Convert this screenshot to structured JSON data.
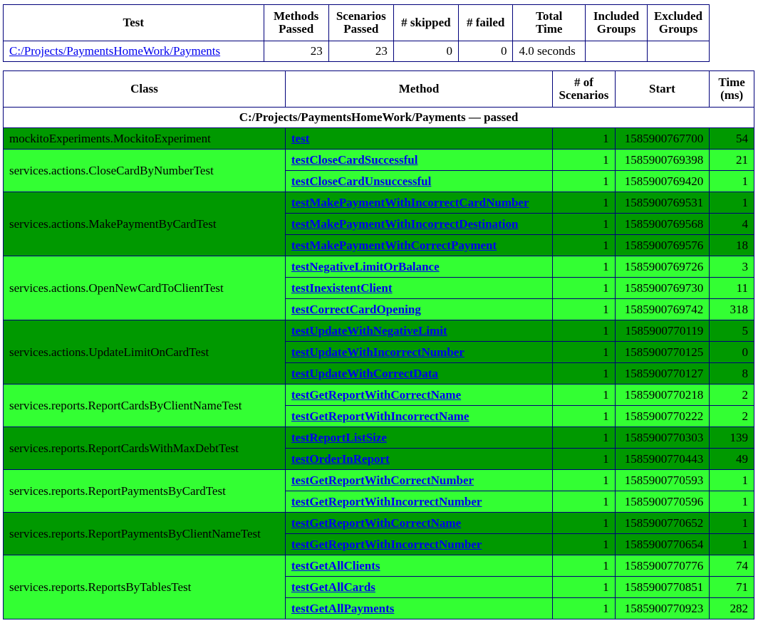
{
  "summary": {
    "headers": [
      "Test",
      "Methods\nPassed",
      "Scenarios\nPassed",
      "# skipped",
      "# failed",
      "Total\nTime",
      "Included\nGroups",
      "Excluded\nGroups"
    ],
    "row": {
      "test": "C:/Projects/PaymentsHomeWork/Payments",
      "methods_passed": "23",
      "scenarios_passed": "23",
      "skipped": "0",
      "failed": "0",
      "total_time": "4.0 seconds",
      "included_groups": "",
      "excluded_groups": ""
    }
  },
  "detail": {
    "headers": [
      "Class",
      "Method",
      "# of\nScenarios",
      "Start",
      "Time\n(ms)"
    ],
    "suite_title": "C:/Projects/PaymentsHomeWork/Payments — passed",
    "colors": {
      "dark": "#009900",
      "light": "#33ff33",
      "link": "#0000ee",
      "border": "#00007a"
    },
    "classes": [
      {
        "name": "mockitoExperiments.MockitoExperiment",
        "shade": "dark",
        "methods": [
          {
            "method": "test",
            "scenarios": "1",
            "start": "1585900767700",
            "time": "54"
          }
        ]
      },
      {
        "name": "services.actions.CloseCardByNumberTest",
        "shade": "light",
        "methods": [
          {
            "method": "testCloseCardSuccessful",
            "scenarios": "1",
            "start": "1585900769398",
            "time": "21"
          },
          {
            "method": "testCloseCardUnsuccessful",
            "scenarios": "1",
            "start": "1585900769420",
            "time": "1"
          }
        ]
      },
      {
        "name": "services.actions.MakePaymentByCardTest",
        "shade": "dark",
        "methods": [
          {
            "method": "testMakePaymentWithIncorrectCardNumber",
            "scenarios": "1",
            "start": "1585900769531",
            "time": "1"
          },
          {
            "method": "testMakePaymentWithIncorrectDestination",
            "scenarios": "1",
            "start": "1585900769568",
            "time": "4"
          },
          {
            "method": "testMakePaymentWithCorrectPayment",
            "scenarios": "1",
            "start": "1585900769576",
            "time": "18"
          }
        ]
      },
      {
        "name": "services.actions.OpenNewCardToClientTest",
        "shade": "light",
        "methods": [
          {
            "method": "testNegativeLimitOrBalance",
            "scenarios": "1",
            "start": "1585900769726",
            "time": "3"
          },
          {
            "method": "testInexistentClient",
            "scenarios": "1",
            "start": "1585900769730",
            "time": "11"
          },
          {
            "method": "testCorrectCardOpening",
            "scenarios": "1",
            "start": "1585900769742",
            "time": "318"
          }
        ]
      },
      {
        "name": "services.actions.UpdateLimitOnCardTest",
        "shade": "dark",
        "methods": [
          {
            "method": "testUpdateWithNegativeLimit",
            "scenarios": "1",
            "start": "1585900770119",
            "time": "5"
          },
          {
            "method": "testUpdateWithIncorrectNumber",
            "scenarios": "1",
            "start": "1585900770125",
            "time": "0"
          },
          {
            "method": "testUpdateWithCorrectData",
            "scenarios": "1",
            "start": "1585900770127",
            "time": "8"
          }
        ]
      },
      {
        "name": "services.reports.ReportCardsByClientNameTest",
        "shade": "light",
        "methods": [
          {
            "method": "testGetReportWithCorrectName",
            "scenarios": "1",
            "start": "1585900770218",
            "time": "2"
          },
          {
            "method": "testGetReportWithIncorrectName",
            "scenarios": "1",
            "start": "1585900770222",
            "time": "2"
          }
        ]
      },
      {
        "name": "services.reports.ReportCardsWithMaxDebtTest",
        "shade": "dark",
        "methods": [
          {
            "method": "testReportListSize",
            "scenarios": "1",
            "start": "1585900770303",
            "time": "139"
          },
          {
            "method": "testOrderInReport",
            "scenarios": "1",
            "start": "1585900770443",
            "time": "49"
          }
        ]
      },
      {
        "name": "services.reports.ReportPaymentsByCardTest",
        "shade": "light",
        "methods": [
          {
            "method": "testGetReportWithCorrectNumber",
            "scenarios": "1",
            "start": "1585900770593",
            "time": "1"
          },
          {
            "method": "testGetReportWithIncorrectNumber",
            "scenarios": "1",
            "start": "1585900770596",
            "time": "1"
          }
        ]
      },
      {
        "name": "services.reports.ReportPaymentsByClientNameTest",
        "shade": "dark",
        "methods": [
          {
            "method": "testGetReportWithCorrectName",
            "scenarios": "1",
            "start": "1585900770652",
            "time": "1"
          },
          {
            "method": "testGetReportWithIncorrectNumber",
            "scenarios": "1",
            "start": "1585900770654",
            "time": "1"
          }
        ]
      },
      {
        "name": "services.reports.ReportsByTablesTest",
        "shade": "light",
        "methods": [
          {
            "method": "testGetAllClients",
            "scenarios": "1",
            "start": "1585900770776",
            "time": "74"
          },
          {
            "method": "testGetAllCards",
            "scenarios": "1",
            "start": "1585900770851",
            "time": "71"
          },
          {
            "method": "testGetAllPayments",
            "scenarios": "1",
            "start": "1585900770923",
            "time": "282"
          }
        ]
      }
    ]
  }
}
